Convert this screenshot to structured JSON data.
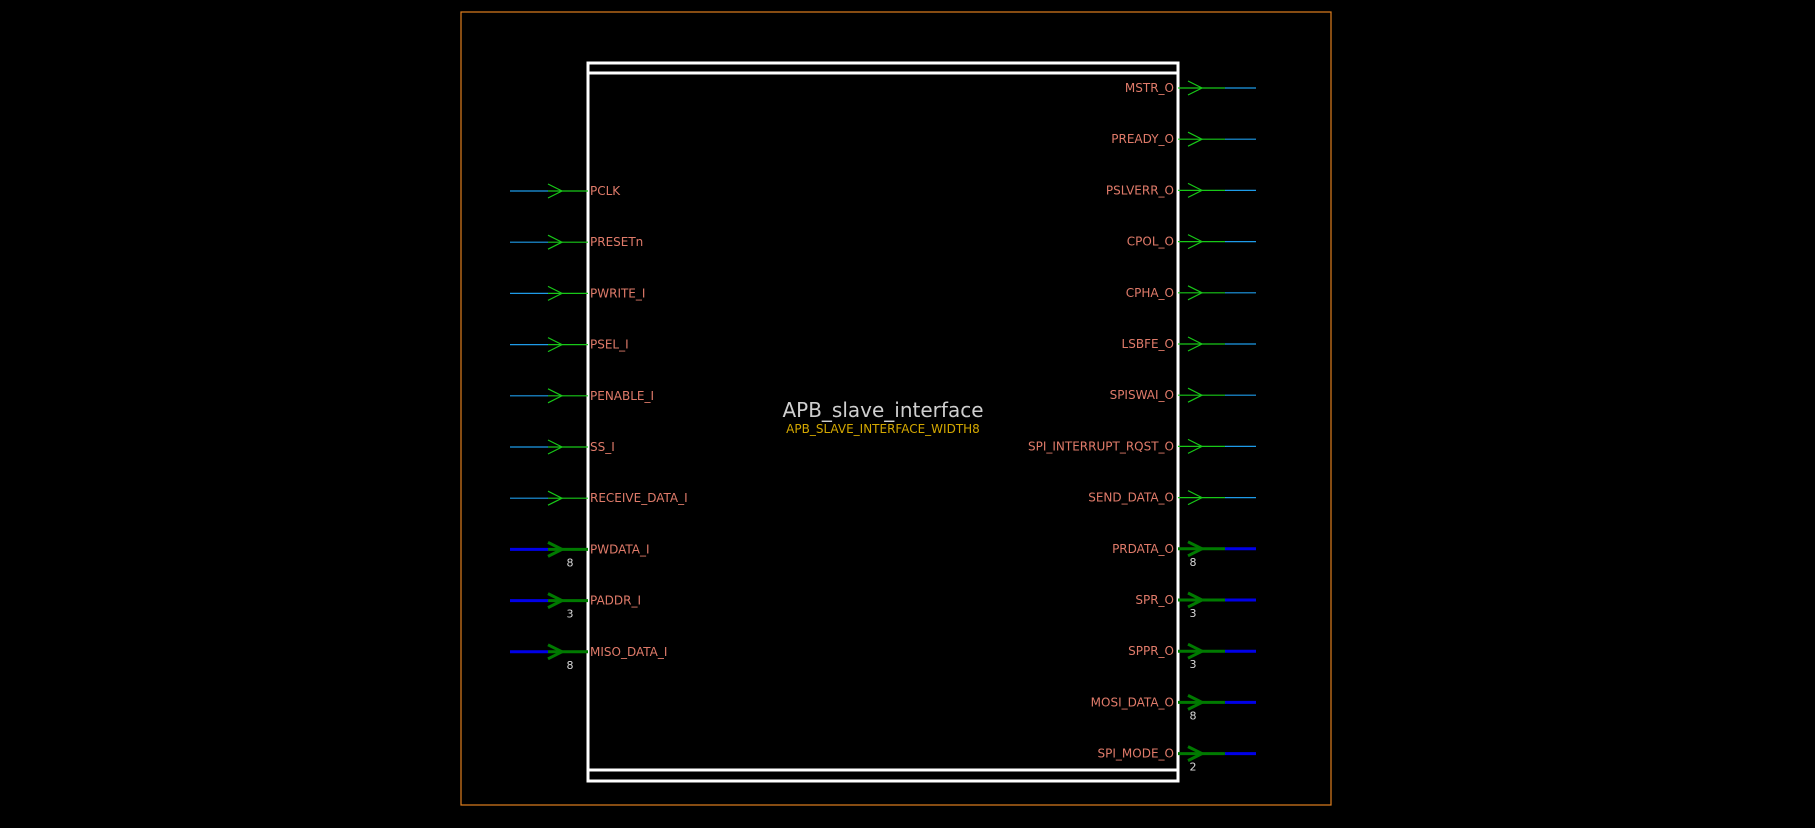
{
  "module": {
    "name": "APB_slave_interface",
    "parameter": "APB_SLAVE_INTERFACE_WIDTH8"
  },
  "colors": {
    "background": "#000000",
    "frame": "#e07f1f",
    "block": "#ffffff",
    "port_label": "#e07b6a",
    "single_wire": "#1e9be8",
    "single_arrow": "#18c818",
    "bus_wire": "#0000e8",
    "bus_arrow": "#007a00",
    "width_label": "#d8d8d8",
    "module_name": "#cfcfcf",
    "module_param": "#d4a800"
  },
  "inputs": [
    {
      "name": "PCLK",
      "width": ""
    },
    {
      "name": "PRESETn",
      "width": ""
    },
    {
      "name": "PWRITE_I",
      "width": ""
    },
    {
      "name": "PSEL_I",
      "width": ""
    },
    {
      "name": "PENABLE_I",
      "width": ""
    },
    {
      "name": "SS_I",
      "width": ""
    },
    {
      "name": "RECEIVE_DATA_I",
      "width": ""
    },
    {
      "name": "PWDATA_I",
      "width": "8"
    },
    {
      "name": "PADDR_I",
      "width": "3"
    },
    {
      "name": "MISO_DATA_I",
      "width": "8"
    }
  ],
  "outputs": [
    {
      "name": "MSTR_O",
      "width": ""
    },
    {
      "name": "PREADY_O",
      "width": ""
    },
    {
      "name": "PSLVERR_O",
      "width": ""
    },
    {
      "name": "CPOL_O",
      "width": ""
    },
    {
      "name": "CPHA_O",
      "width": ""
    },
    {
      "name": "LSBFE_O",
      "width": ""
    },
    {
      "name": "SPISWAI_O",
      "width": ""
    },
    {
      "name": "SPI_INTERRUPT_RQST_O",
      "width": ""
    },
    {
      "name": "SEND_DATA_O",
      "width": ""
    },
    {
      "name": "PRDATA_O",
      "width": "8"
    },
    {
      "name": "SPR_O",
      "width": "3"
    },
    {
      "name": "SPPR_O",
      "width": "3"
    },
    {
      "name": "MOSI_DATA_O",
      "width": "8"
    },
    {
      "name": "SPI_MODE_O",
      "width": "2"
    }
  ]
}
